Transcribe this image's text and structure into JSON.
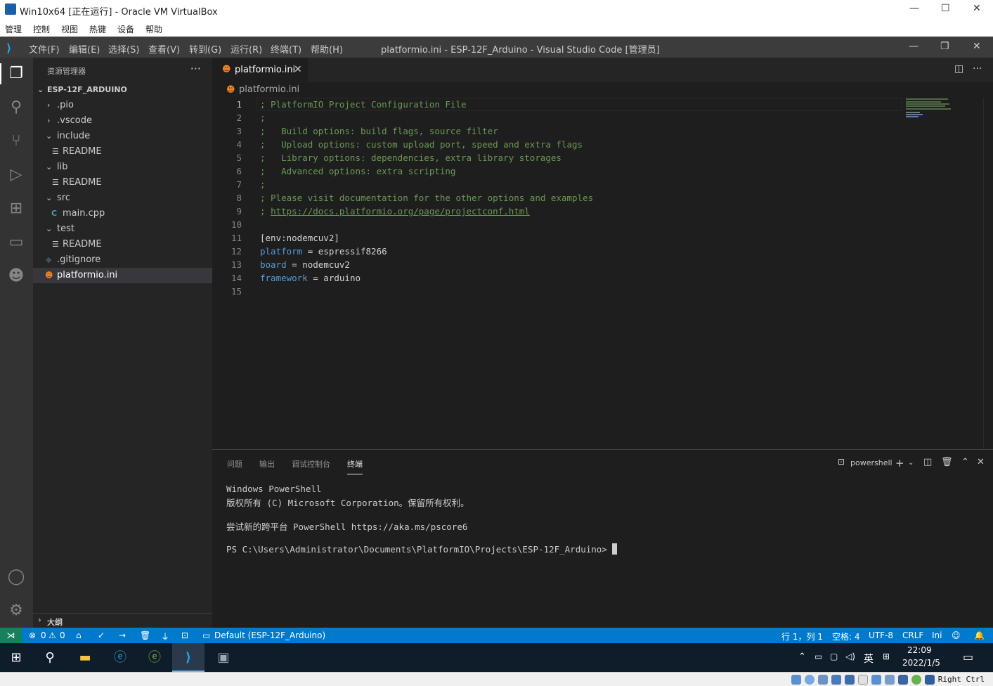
{
  "vbox": {
    "title": "Win10x64 [正在运行] - Oracle VM VirtualBox",
    "menu": [
      "管理",
      "控制",
      "视图",
      "热键",
      "设备",
      "帮助"
    ],
    "host_key": "Right Ctrl"
  },
  "vscode": {
    "menu": [
      "文件(F)",
      "编辑(E)",
      "选择(S)",
      "查看(V)",
      "转到(G)",
      "运行(R)",
      "终端(T)",
      "帮助(H)"
    ],
    "window_title": "platformio.ini - ESP-12F_Arduino - Visual Studio Code [管理员]"
  },
  "sidebar": {
    "header": "资源管理器",
    "more": "···",
    "root": "ESP-12F_ARDUINO",
    "items": [
      {
        "label": ".pio",
        "kind": "folder-collapsed"
      },
      {
        "label": ".vscode",
        "kind": "folder-collapsed"
      },
      {
        "label": "include",
        "kind": "folder-open"
      },
      {
        "label": "README",
        "kind": "file"
      },
      {
        "label": "lib",
        "kind": "folder-open"
      },
      {
        "label": "README",
        "kind": "file"
      },
      {
        "label": "src",
        "kind": "folder-open"
      },
      {
        "label": "main.cpp",
        "kind": "file"
      },
      {
        "label": "test",
        "kind": "folder-open"
      },
      {
        "label": "README",
        "kind": "file"
      },
      {
        "label": ".gitignore",
        "kind": "file"
      },
      {
        "label": "platformio.ini",
        "kind": "file",
        "selected": true
      }
    ],
    "outline": "大纲"
  },
  "editor": {
    "tab": "platformio.ini",
    "breadcrumb": "platformio.ini",
    "current_line": 1,
    "line_numbers": [
      "1",
      "2",
      "3",
      "4",
      "5",
      "6",
      "7",
      "8",
      "9",
      "10",
      "11",
      "12",
      "13",
      "14",
      "15"
    ],
    "lines": [
      "; PlatformIO Project Configuration File",
      ";",
      ";   Build options: build flags, source filter",
      ";   Upload options: custom upload port, speed and extra flags",
      ";   Library options: dependencies, extra library storages",
      ";   Advanced options: extra scripting",
      ";",
      "; Please visit documentation for the other options and examples",
      "https://docs.platformio.org/page/projectconf.html",
      "",
      "[env:nodemcuv2]",
      "platform",
      "board",
      "framework",
      ""
    ],
    "line9_prefix": "; ",
    "values": {
      "platform": " = espressif8266",
      "board": " = nodemcuv2",
      "framework": " = arduino"
    }
  },
  "panel": {
    "tabs": [
      "问题",
      "输出",
      "调试控制台",
      "终端"
    ],
    "active_tab": "终端",
    "shell": "powershell",
    "terminal": [
      "Windows PowerShell",
      "版权所有 (C) Microsoft Corporation。保留所有权利。",
      "",
      "尝试新的跨平台 PowerShell https://aka.ms/pscore6",
      "",
      "PS C:\\Users\\Administrator\\Documents\\PlatformIO\\Projects\\ESP-12F_Arduino> "
    ]
  },
  "status": {
    "errors": "0",
    "warnings": "0",
    "env": "Default (ESP-12F_Arduino)",
    "position": "行 1，列 1",
    "spaces": "空格: 4",
    "encoding": "UTF-8",
    "eol": "CRLF",
    "language": "Ini"
  },
  "taskbar": {
    "ime": "英",
    "time": "22:09",
    "date": "2022/1/5"
  },
  "colors": {
    "status_bar": "#007acc",
    "remote": "#16825d",
    "comment": "#6a9955",
    "keyword": "#569cd6"
  }
}
